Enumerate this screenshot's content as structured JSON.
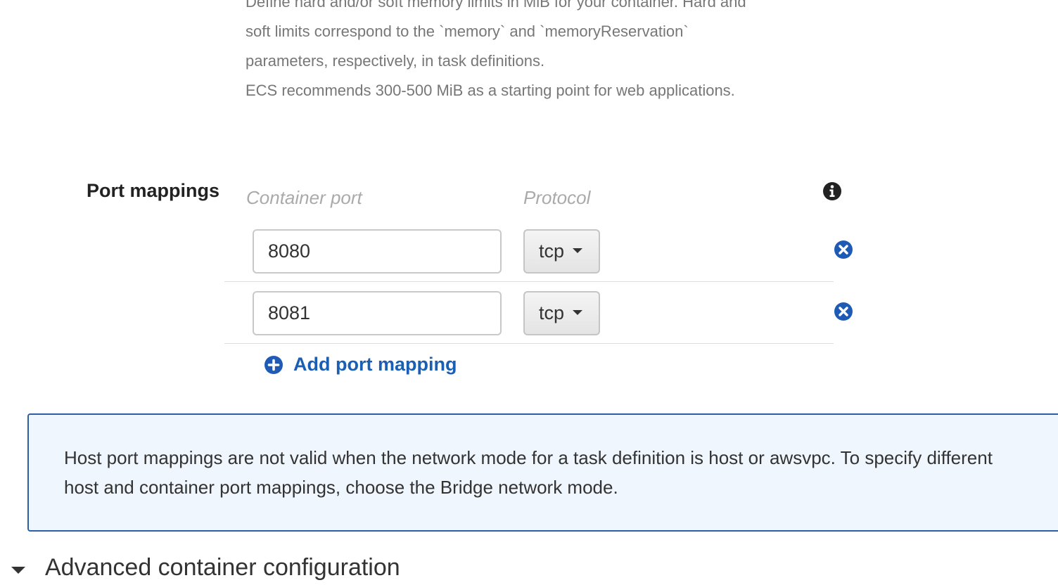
{
  "memory_help": {
    "lines": [
      "Define hard and/or soft memory limits in MiB for your container. Hard and",
      "soft limits correspond to the `memory` and `memoryReservation`",
      "parameters, respectively, in task definitions.",
      "ECS recommends 300-500 MiB as a starting point for web applications."
    ]
  },
  "port_mappings": {
    "label": "Port mappings",
    "container_port_header": "Container port",
    "protocol_header": "Protocol",
    "info_icon": "info-circle-icon",
    "rows": [
      {
        "container_port": "8080",
        "protocol": "tcp"
      },
      {
        "container_port": "8081",
        "protocol": "tcp"
      }
    ],
    "add_label": "Add port mapping"
  },
  "notice": {
    "text": "Host port mappings are not valid when the network mode for a task definition is host or awsvpc. To specify different host and container port mappings, choose the Bridge network mode."
  },
  "advanced": {
    "label": "Advanced container configuration"
  },
  "colors": {
    "accent": "#1a5fb4",
    "notice_border": "#2b5fa3",
    "notice_bg": "#eff6fd"
  }
}
